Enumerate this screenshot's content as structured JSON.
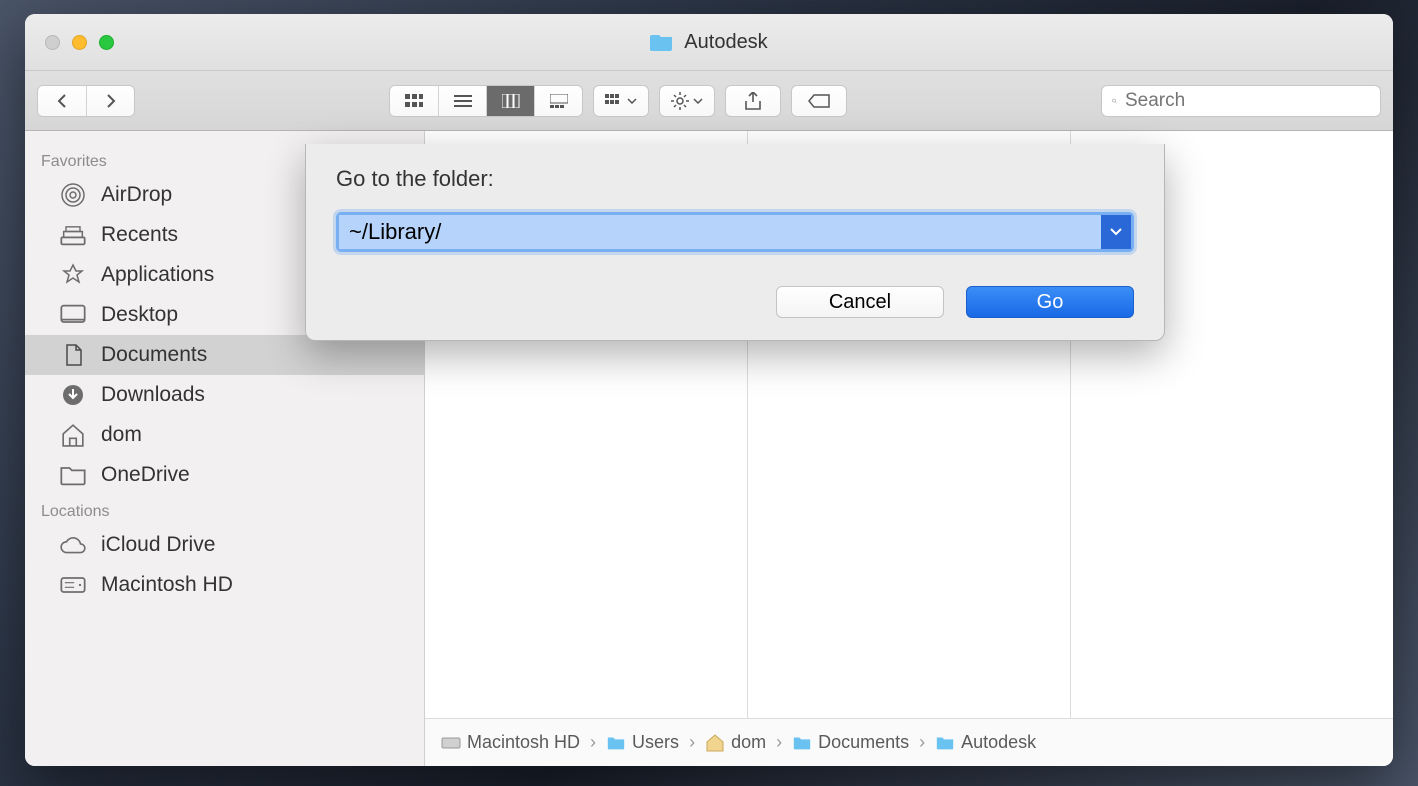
{
  "window": {
    "title": "Autodesk"
  },
  "toolbar": {
    "search_placeholder": "Search"
  },
  "sidebar": {
    "sections": [
      {
        "header": "Favorites",
        "items": [
          {
            "label": "AirDrop"
          },
          {
            "label": "Recents"
          },
          {
            "label": "Applications"
          },
          {
            "label": "Desktop"
          },
          {
            "label": "Documents",
            "selected": true
          },
          {
            "label": "Downloads"
          },
          {
            "label": "dom"
          },
          {
            "label": "OneDrive"
          }
        ]
      },
      {
        "header": "Locations",
        "items": [
          {
            "label": "iCloud Drive"
          },
          {
            "label": "Macintosh HD"
          }
        ]
      }
    ]
  },
  "pathbar": {
    "segments": [
      {
        "label": "Macintosh HD",
        "icon": "disk"
      },
      {
        "label": "Users",
        "icon": "folder"
      },
      {
        "label": "dom",
        "icon": "home"
      },
      {
        "label": "Documents",
        "icon": "folder"
      },
      {
        "label": "Autodesk",
        "icon": "folder"
      }
    ]
  },
  "dialog": {
    "heading": "Go to the folder:",
    "value": "~/Library/",
    "cancel": "Cancel",
    "go": "Go"
  }
}
